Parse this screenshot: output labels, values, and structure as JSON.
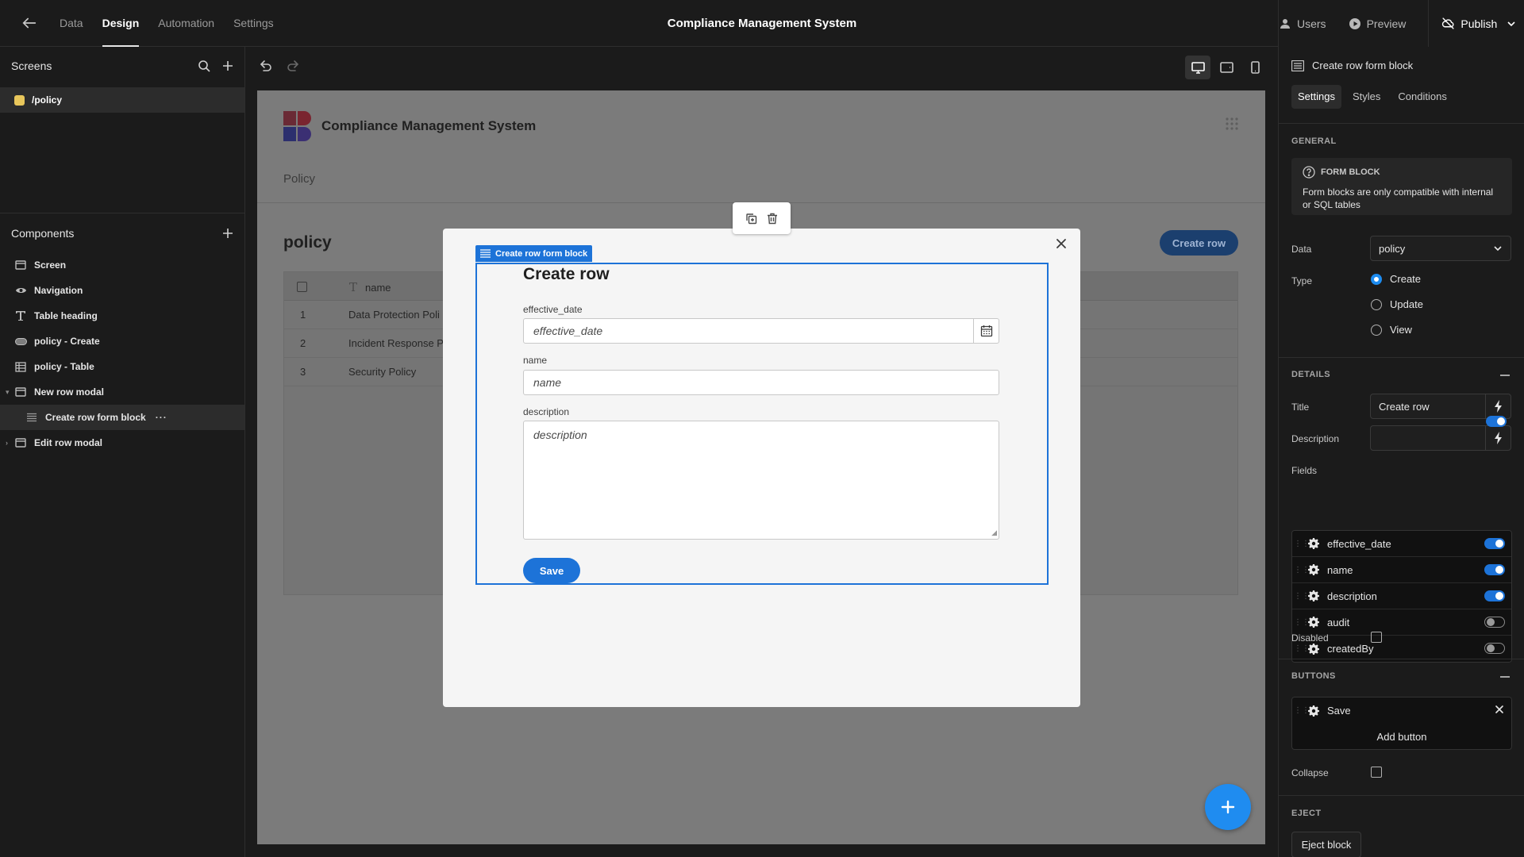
{
  "topbar": {
    "tabs": [
      {
        "label": "Data",
        "active": false
      },
      {
        "label": "Design",
        "active": true
      },
      {
        "label": "Automation",
        "active": false
      },
      {
        "label": "Settings",
        "active": false
      }
    ],
    "app_title": "Compliance Management System",
    "users_label": "Users",
    "preview_label": "Preview",
    "publish_label": "Publish"
  },
  "left_panel": {
    "screens_title": "Screens",
    "screen_route": "/policy",
    "screen_color": "#e8c65b",
    "components_title": "Components",
    "components": [
      {
        "label": "Screen",
        "icon": "screen-icon"
      },
      {
        "label": "Navigation",
        "icon": "eye-icon"
      },
      {
        "label": "Table heading",
        "icon": "text-icon"
      },
      {
        "label": "policy - Create",
        "icon": "button-icon"
      },
      {
        "label": "policy - Table",
        "icon": "table-icon"
      },
      {
        "label": "New row modal",
        "icon": "modal-icon"
      },
      {
        "label": "Create row form block",
        "icon": "form-icon"
      },
      {
        "label": "Edit row modal",
        "icon": "modal-icon"
      }
    ]
  },
  "preview": {
    "brand_name": "Compliance Management System",
    "breadcrumb": "Policy",
    "heading": "policy",
    "create_row_button": "Create row",
    "table": {
      "column_name": "name",
      "rows": [
        {
          "num": "1",
          "name": "Data Protection Poli"
        },
        {
          "num": "2",
          "name": "Incident Response P"
        },
        {
          "num": "3",
          "name": "Security Policy"
        }
      ]
    }
  },
  "modal": {
    "tag_label": "Create row form block",
    "form_title": "Create row",
    "fields": [
      {
        "label": "effective_date",
        "placeholder": "effective_date"
      },
      {
        "label": "name",
        "placeholder": "name"
      },
      {
        "label": "description",
        "placeholder": "description"
      }
    ],
    "save_label": "Save"
  },
  "right_panel": {
    "block_title": "Create row form block",
    "tabs": [
      {
        "label": "Settings",
        "active": true
      },
      {
        "label": "Styles",
        "active": false
      },
      {
        "label": "Conditions",
        "active": false
      }
    ],
    "general_title": "GENERAL",
    "info_heading": "FORM BLOCK",
    "info_text": "Form blocks are only compatible with internal or SQL tables",
    "data_label": "Data",
    "data_value": "policy",
    "type_label": "Type",
    "type_options": [
      {
        "label": "Create",
        "selected": true
      },
      {
        "label": "Update",
        "selected": false
      },
      {
        "label": "View",
        "selected": false
      }
    ],
    "details_title": "DETAILS",
    "title_label": "Title",
    "title_value": "Create row",
    "description_label": "Description",
    "description_value": "",
    "fields_label": "Fields",
    "fields_enabled": true,
    "field_list": [
      {
        "name": "effective_date",
        "enabled": true
      },
      {
        "name": "name",
        "enabled": true
      },
      {
        "name": "description",
        "enabled": true
      },
      {
        "name": "audit",
        "enabled": false
      },
      {
        "name": "createdBy",
        "enabled": false
      }
    ],
    "disabled_label": "Disabled",
    "buttons_title": "BUTTONS",
    "button_item": "Save",
    "add_button_label": "Add button",
    "collapse_label": "Collapse",
    "eject_title": "EJECT",
    "eject_button": "Eject block"
  },
  "colors": {
    "accent": "#1d73d8",
    "fab": "#1f8cf0"
  }
}
